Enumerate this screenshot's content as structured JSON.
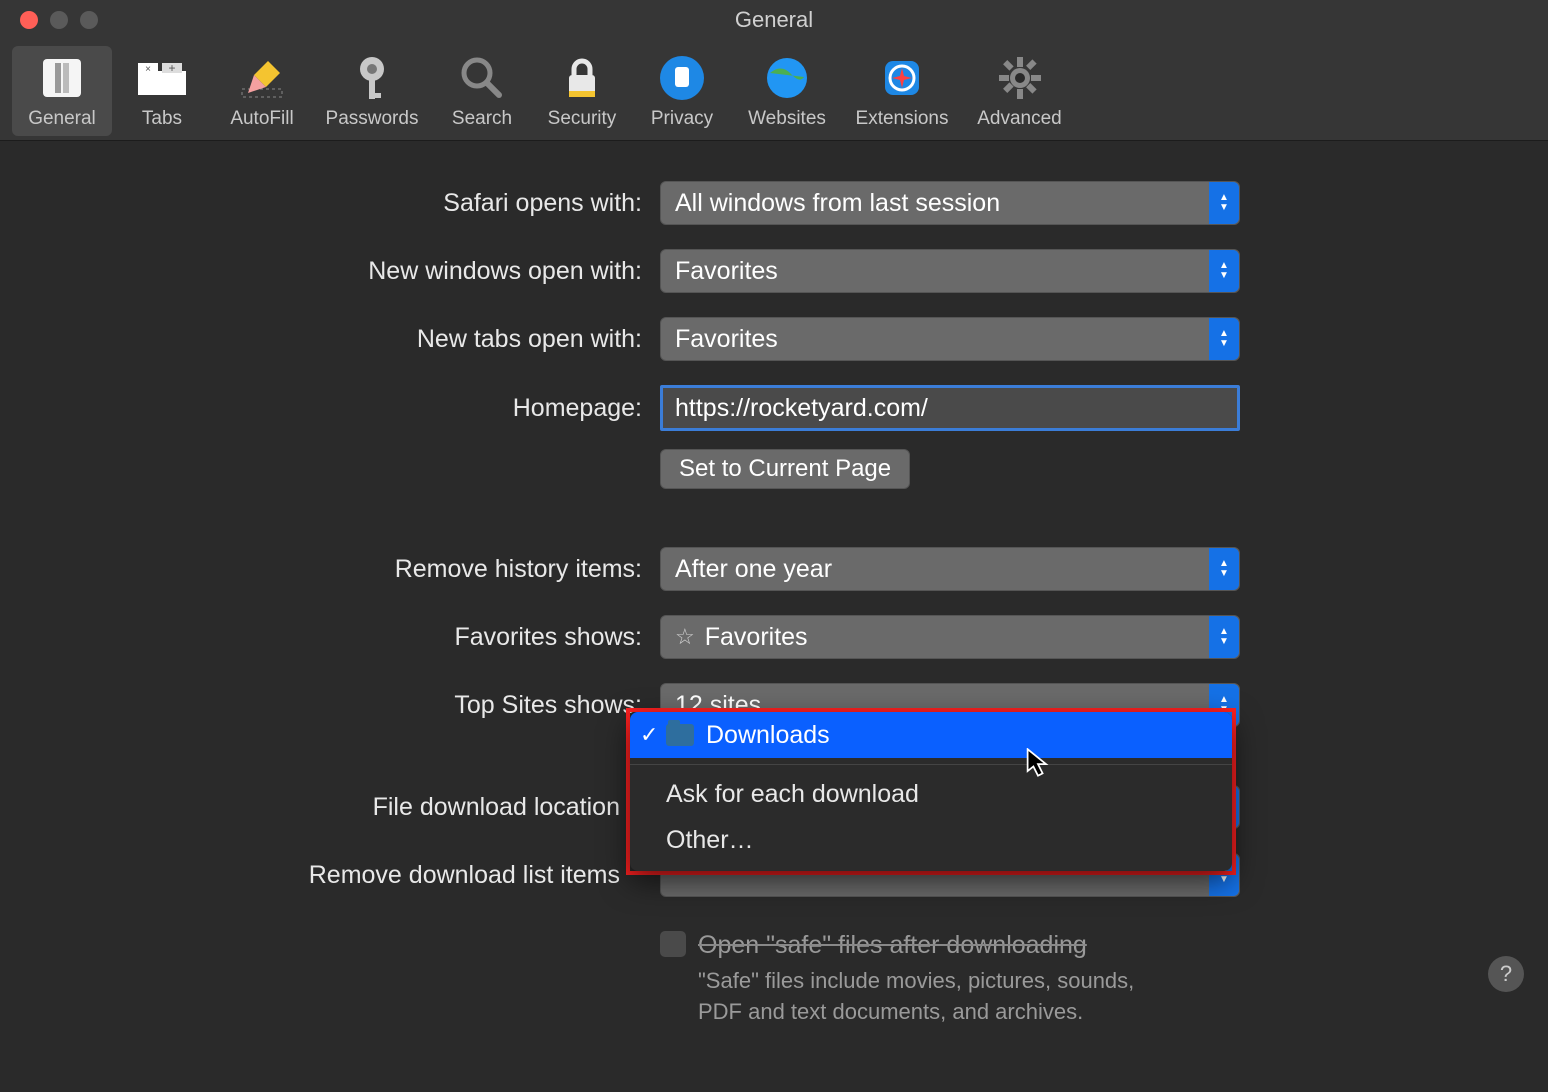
{
  "window": {
    "title": "General"
  },
  "toolbar": {
    "items": [
      {
        "name": "general",
        "label": "General"
      },
      {
        "name": "tabs",
        "label": "Tabs"
      },
      {
        "name": "autofill",
        "label": "AutoFill"
      },
      {
        "name": "passwords",
        "label": "Passwords"
      },
      {
        "name": "search",
        "label": "Search"
      },
      {
        "name": "security",
        "label": "Security"
      },
      {
        "name": "privacy",
        "label": "Privacy"
      },
      {
        "name": "websites",
        "label": "Websites"
      },
      {
        "name": "extensions",
        "label": "Extensions"
      },
      {
        "name": "advanced",
        "label": "Advanced"
      }
    ]
  },
  "form": {
    "safari_opens_with": {
      "label": "Safari opens with:",
      "value": "All windows from last session"
    },
    "new_windows_open_with": {
      "label": "New windows open with:",
      "value": "Favorites"
    },
    "new_tabs_open_with": {
      "label": "New tabs open with:",
      "value": "Favorites"
    },
    "homepage": {
      "label": "Homepage:",
      "value": "https://rocketyard.com/"
    },
    "set_current_page": {
      "label": "Set to Current Page"
    },
    "remove_history_items": {
      "label": "Remove history items:",
      "value": "After one year"
    },
    "favorites_shows": {
      "label": "Favorites shows:",
      "value": "Favorites"
    },
    "top_sites_shows": {
      "label": "Top Sites shows:",
      "value": "12 sites"
    },
    "file_download_location": {
      "label": "File download location",
      "value": "Downloads"
    },
    "remove_download_list": {
      "label": "Remove download list items"
    },
    "open_safe": {
      "label": "Open \"safe\" files after downloading",
      "description": "\"Safe\" files include movies, pictures, sounds, PDF and text documents, and archives."
    }
  },
  "menu": {
    "downloads": "Downloads",
    "ask": "Ask for each download",
    "other": "Other…"
  },
  "help": "?"
}
